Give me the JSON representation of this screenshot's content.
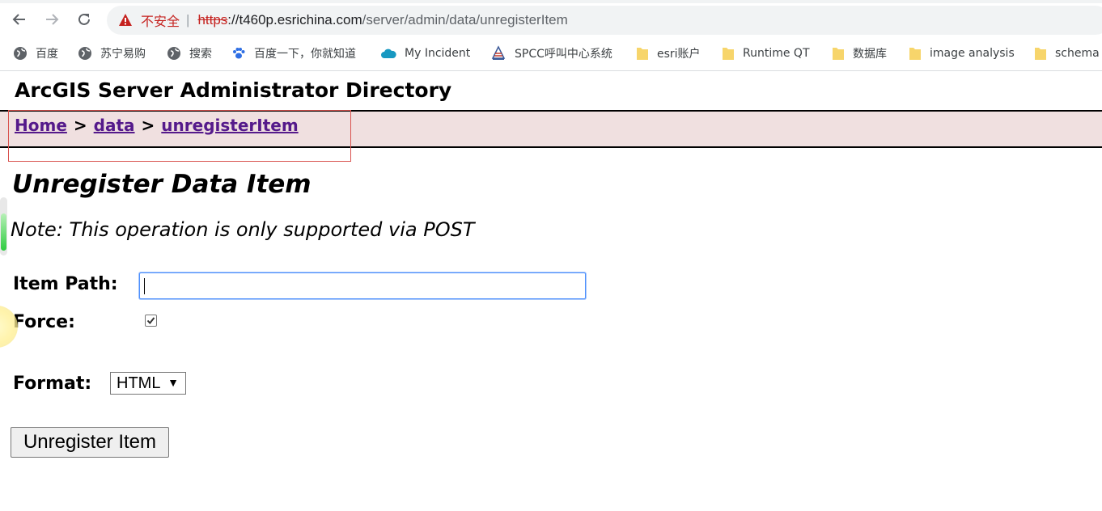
{
  "browser": {
    "security_label": "不安全",
    "url_scheme": "https",
    "url_host": "://t460p.esrichina.com",
    "url_path": "/server/admin/data/unregisterItem",
    "bookmarks": [
      {
        "label": "百度",
        "icon": "globe-icon"
      },
      {
        "label": "苏宁易购",
        "icon": "globe-icon"
      },
      {
        "label": "搜索",
        "icon": "globe-icon"
      },
      {
        "label": "百度一下，你就知道",
        "icon": "paw-icon"
      },
      {
        "label": "My Incident",
        "icon": "cloud-icon"
      },
      {
        "label": "SPCC呼叫中心系统",
        "icon": "tower-icon"
      },
      {
        "label": "esri账户",
        "icon": "folder-icon"
      },
      {
        "label": "Runtime QT",
        "icon": "folder-icon"
      },
      {
        "label": "数据库",
        "icon": "folder-icon"
      },
      {
        "label": "image analysis",
        "icon": "folder-icon"
      },
      {
        "label": "schema",
        "icon": "folder-icon"
      }
    ]
  },
  "page": {
    "app_title": "ArcGIS Server Administrator Directory",
    "breadcrumb": {
      "home": "Home",
      "sep": ">",
      "data": "data",
      "current": "unregisterItem"
    },
    "heading": "Unregister Data Item",
    "note": "Note: This operation is only supported via POST",
    "form": {
      "item_path_label": "Item Path:",
      "item_path_value": "",
      "force_label": "Force:",
      "force_checked": true,
      "format_label": "Format:",
      "format_value": "HTML",
      "submit_label": "Unregister Item"
    }
  },
  "colors": {
    "breadcrumb_bg": "#f0e0e0",
    "link": "#551a8b",
    "insecure_red": "#c5221f"
  }
}
